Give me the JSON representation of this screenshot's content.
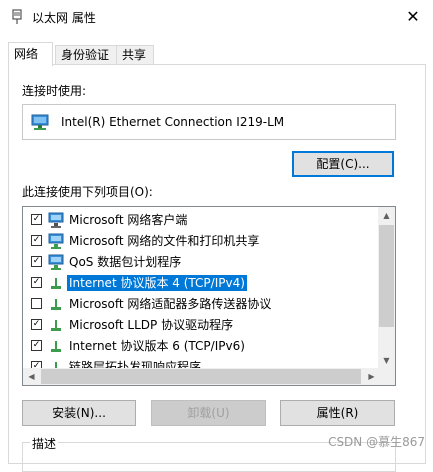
{
  "window": {
    "title": "以太网 属性",
    "close_glyph": "✕"
  },
  "tabs": [
    {
      "label": "网络",
      "active": true
    },
    {
      "label": "身份验证",
      "active": false
    },
    {
      "label": "共享",
      "active": false
    }
  ],
  "connect_using": {
    "label": "连接时使用:",
    "adapter": "Intel(R) Ethernet Connection I219-LM",
    "icon": "network-adapter-icon"
  },
  "configure_button": "配置(C)...",
  "items_label": "此连接使用下列项目(O):",
  "items": [
    {
      "label": "Microsoft 网络客户端",
      "checked": true,
      "icon": "network-client-icon",
      "selected": false
    },
    {
      "label": "Microsoft 网络的文件和打印机共享",
      "checked": true,
      "icon": "network-service-icon",
      "selected": false
    },
    {
      "label": "QoS 数据包计划程序",
      "checked": true,
      "icon": "network-service-icon",
      "selected": false
    },
    {
      "label": "Internet 协议版本 4 (TCP/IPv4)",
      "checked": true,
      "icon": "protocol-icon",
      "selected": true
    },
    {
      "label": "Microsoft 网络适配器多路传送器协议",
      "checked": false,
      "icon": "protocol-icon",
      "selected": false
    },
    {
      "label": "Microsoft LLDP 协议驱动程序",
      "checked": true,
      "icon": "protocol-icon",
      "selected": false
    },
    {
      "label": "Internet 协议版本 6 (TCP/IPv6)",
      "checked": true,
      "icon": "protocol-icon",
      "selected": false
    },
    {
      "label": "链路层拓扑发现响应程序",
      "checked": true,
      "icon": "protocol-icon",
      "selected": false
    }
  ],
  "buttons": {
    "install": "安装(N)...",
    "uninstall": "卸载(U)",
    "properties": "属性(R)"
  },
  "description_label": "描述",
  "watermark": "CSDN @慕生867",
  "colors": {
    "selection": "#0078d7",
    "focus_border": "#0078d7"
  }
}
